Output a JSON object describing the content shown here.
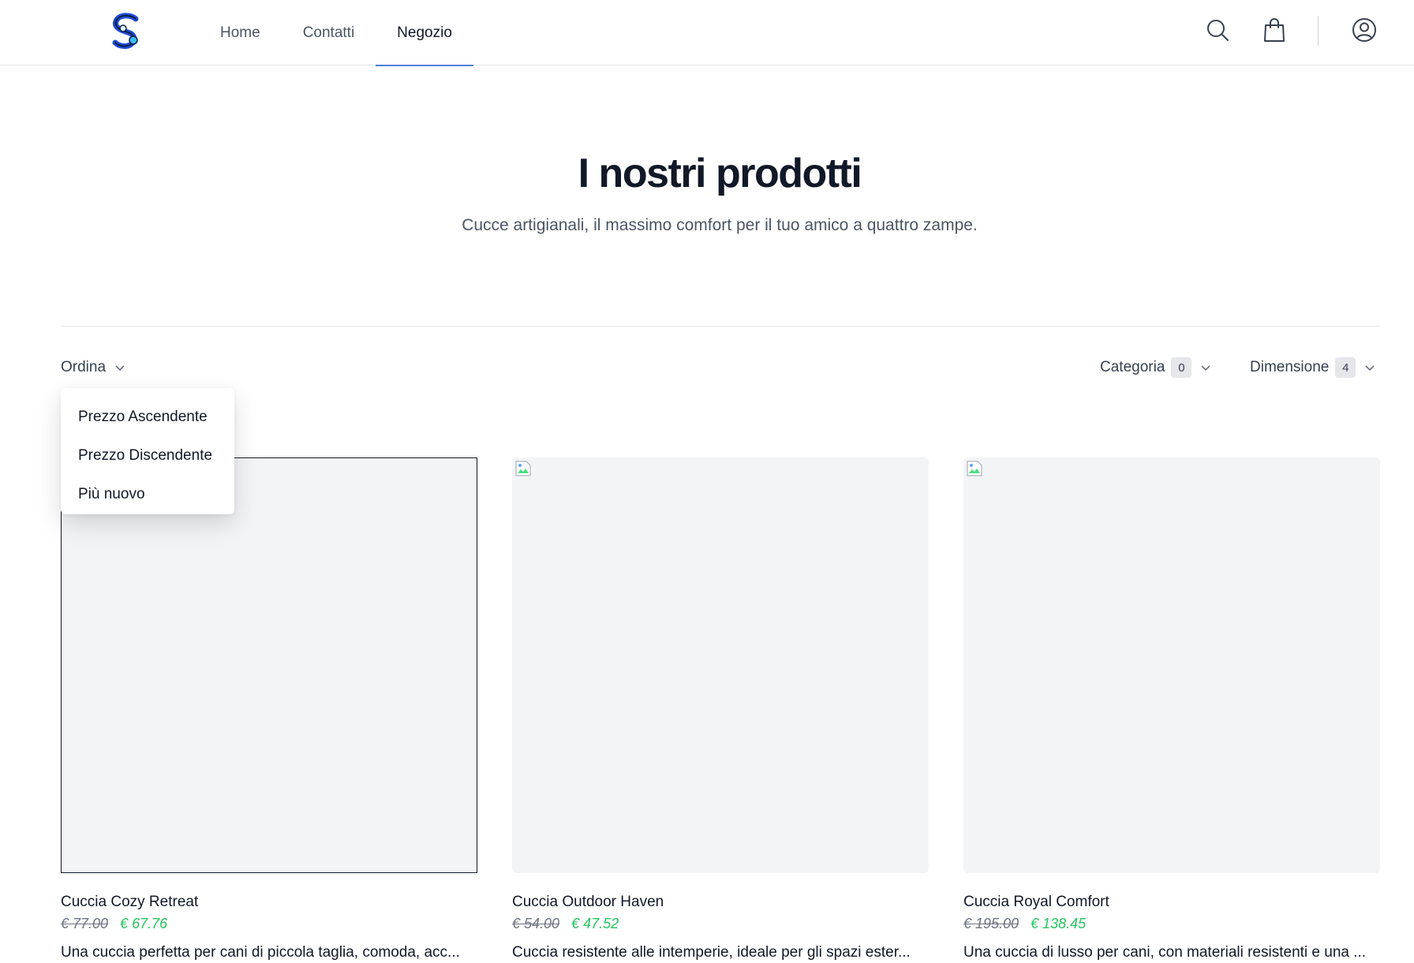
{
  "header": {
    "nav": [
      {
        "label": "Home",
        "active": false
      },
      {
        "label": "Contatti",
        "active": false
      },
      {
        "label": "Negozio",
        "active": true
      }
    ],
    "icons": [
      "search-icon",
      "shopping-bag-icon",
      "user-icon"
    ]
  },
  "hero": {
    "title": "I nostri prodotti",
    "subtitle": "Cucce artigianali, il massimo comfort per il tuo amico a quattro zampe."
  },
  "filters": {
    "sort_label": "Ordina",
    "category_label": "Categoria",
    "category_count": "0",
    "size_label": "Dimensione",
    "size_count": "4"
  },
  "sort_menu": {
    "options": [
      "Prezzo Ascendente",
      "Prezzo Discendente",
      "Più nuovo"
    ]
  },
  "products": [
    {
      "name": "Cuccia Cozy Retreat",
      "old_price": "€ 77.00",
      "price": "€ 67.76",
      "description": "Una cuccia perfetta per cani di piccola taglia, comoda, acc..."
    },
    {
      "name": "Cuccia Outdoor Haven",
      "old_price": "€ 54.00",
      "price": "€ 47.52",
      "description": "Cuccia resistente alle intemperie, ideale per gli spazi ester..."
    },
    {
      "name": "Cuccia Royal Comfort",
      "old_price": "€ 195.00",
      "price": "€ 138.45",
      "description": "Una cuccia di lusso per cani, con materiali resistenti e una ..."
    }
  ],
  "colors": {
    "accent": "#4f7fd8",
    "sale_price": "#22c55e",
    "image_placeholder": "#f3f4f6"
  }
}
